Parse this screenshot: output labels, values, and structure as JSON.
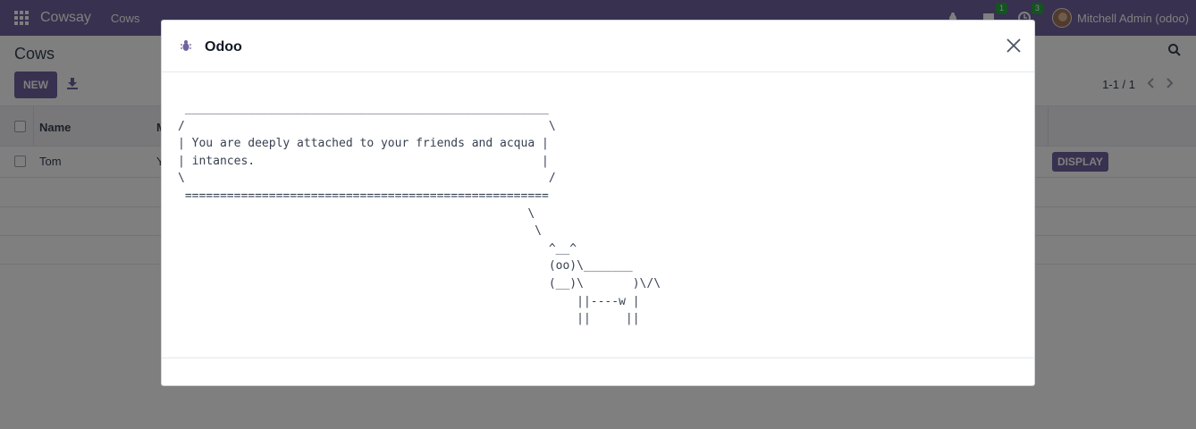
{
  "navbar": {
    "brand": "Cowsay",
    "menu_item": "Cows",
    "messages_count": "1",
    "activities_count": "3",
    "user_name": "Mitchell Admin (odoo)"
  },
  "control_panel": {
    "breadcrumb": "Cows",
    "new_button": "NEW",
    "pager": "1-1 / 1"
  },
  "list": {
    "columns": [
      "Name",
      "M"
    ],
    "rows": [
      {
        "name": "Tom",
        "message_prefix": "Y",
        "action": "DISPLAY"
      }
    ]
  },
  "modal": {
    "title": "Odoo",
    "cowsay_text": " ____________________________________________________\n/                                                    \\\n| You are deeply attached to your friends and acqua |\n| intances.                                         |\n\\                                                    /\n ====================================================\n                                                  \\\n                                                   \\\n                                                     ^__^\n                                                     (oo)\\_______\n                                                     (__)\\       )\\/\\\n                                                         ||----w |\n                                                         ||     ||"
  }
}
